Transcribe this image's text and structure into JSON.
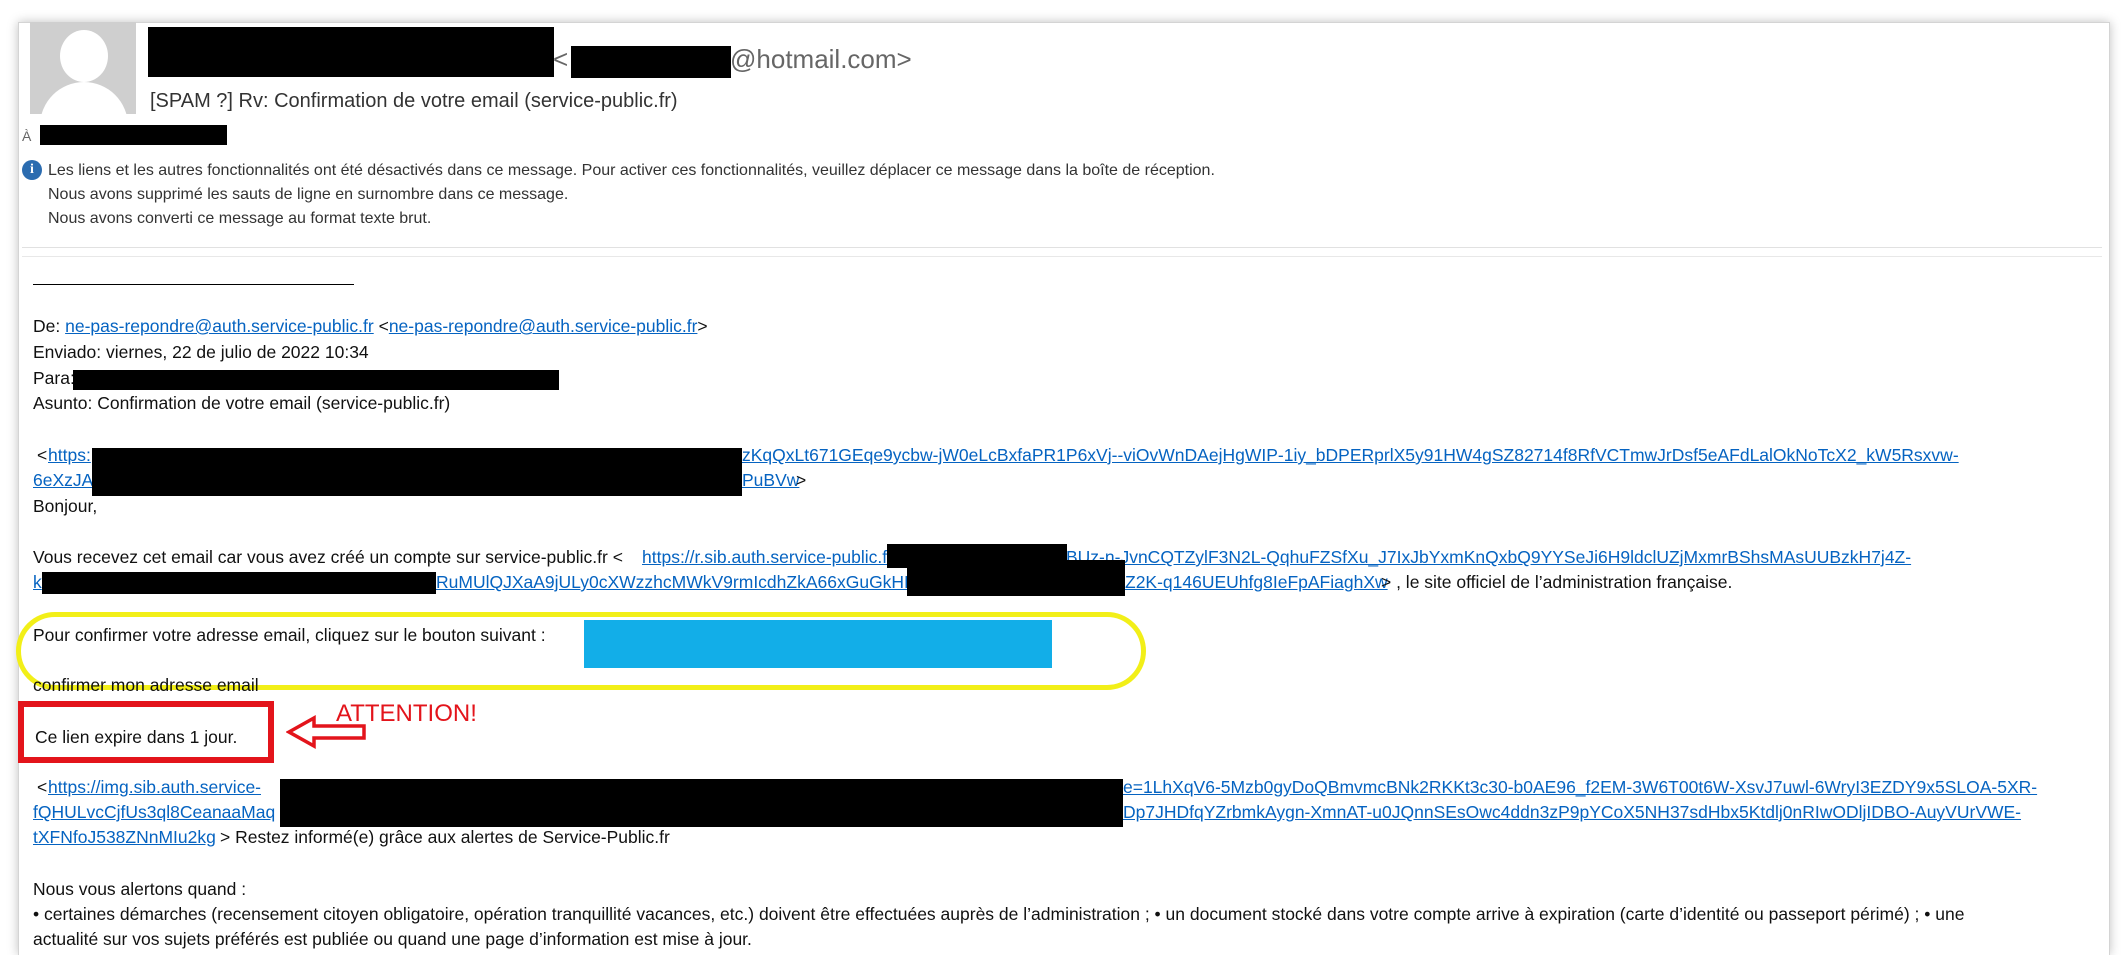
{
  "header": {
    "email_domain_suffix": "@hotmail.com>",
    "email_bracket_open": "<",
    "subject": "[SPAM ?] Rv: Confirmation de votre email (service-public.fr)",
    "to_label": "À"
  },
  "infobar": {
    "line1": "Les liens et les autres fonctionnalités ont été désactivés dans ce message. Pour activer ces fonctionnalités, veuillez déplacer ce message dans la boîte de réception.",
    "line2": "Nous avons supprimé les sauts de ligne en surnombre dans ce message.",
    "line3": "Nous avons converti ce message au format texte brut."
  },
  "forward": {
    "de_label": "De: ",
    "de_link": "ne-pas-repondre@auth.service-public.fr",
    "de_link2": "ne-pas-repondre@auth.service-public.fr",
    "enviado": "Enviado: viernes, 22 de julio de 2022 10:34",
    "para": "Para:",
    "asunto": "Asunto: Confirmation de votre email (service-public.fr)"
  },
  "body": {
    "link1_a": "https:",
    "link1_b": "zKqQxLt671GEqe9ycbw-jW0eLcBxfaPR1P6xVj--viOvWnDAejHgWIP-1iy_bDPERprlX5y91HW4gSZ82714f8RfVCTmwJrDsf5eAFdLalOkNoTcX2_kW5Rsxvw-",
    "link1_c": "6eXzJAi",
    "link1_d": "PuBVw",
    "bonjour": "Bonjour,",
    "recevez": "Vous recevez cet email car vous avez créé un compte sur service-public.fr <",
    "link2_a": "https://r.sib.auth.service-public.f",
    "link2_b": "BUz-n-JvnCQTZylF3N2L-QqhuFZSfXu_J7IxJbYxmKnQxbQ9YYSeJi6H9ldclUZjMxmrBShsMAsUUBzkH7j4Z-",
    "link2_c": "k",
    "link2_d": "RuMUlQJXaA9jULy0cXWzzhcMWkV9rmIcdhZkA66xGuGkHK",
    "link2_e": "Z2K-q146UEUhfg8IeFpAFiaghXw",
    "recevez_tail": "> , le site officiel de l’administration française.",
    "confirm_prompt": "Pour confirmer votre adresse email, cliquez sur le bouton suivant :",
    "confirm_label": "confirmer mon adresse email",
    "expire": "Ce lien expire dans 1 jour.",
    "attention": "ATTENTION!",
    "link3_a": "https://img.sib.auth.service-",
    "link3_b": "e=1LhXqV6-5Mzb0gyDoQBmvmcBNk2RKKt3c30-b0AE96_f2EM-3W6T00t6W-XsvJ7uwl-6WryI3EZDY9x5SLOA-5XR-",
    "link3_c": "fQHULvcCjfUs3ql8CeanaaMaq",
    "link3_d": "Dp7JHDfqYZrbmkAygn-XmnAT-u0JQnnSEsOwc4ddn3zP9pYCoX5NH37sdHbx5Ktdlj0nRIwODljIDBO-AuyVUrVWE-",
    "link3_e": "tXFNfoJ538ZNnMIu2kg",
    "restez": ">  Restez informé(e) grâce aux alertes de Service-Public.fr",
    "alertons": "Nous vous alertons quand :",
    "bullet_line1": "•  certaines démarches (recensement citoyen obligatoire, opération tranquillité vacances, etc.) doivent être effectuées auprès de l’administration ; •  un document stocké dans votre compte arrive à expiration (carte d’identité ou passeport périmé) ; •  une",
    "bullet_line2": "actualité sur vos sujets préférés est publiée ou quand une page d’information est mise à jour."
  },
  "colors": {
    "link": "#0563c1",
    "highlight_yellow": "#f2ef18",
    "highlight_red": "#e3141b",
    "button_cyan": "#12aee8"
  }
}
